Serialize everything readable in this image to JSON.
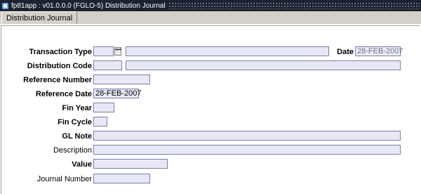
{
  "window": {
    "title": "fp81app : v01.0.0.0 (FGLO-5) Distribution Journal"
  },
  "tabs": [
    {
      "label": "Distribution Journal"
    }
  ],
  "form": {
    "transaction_type": {
      "label": "Transaction Type",
      "code": "",
      "description": ""
    },
    "date": {
      "label": "Date",
      "value": "28-FEB-2007"
    },
    "distribution_code": {
      "label": "Distribution Code",
      "code": "",
      "description": ""
    },
    "reference_number": {
      "label": "Reference Number",
      "value": ""
    },
    "reference_date": {
      "label": "Reference Date",
      "value": "28-FEB-2007"
    },
    "fin_year": {
      "label": "Fin Year",
      "value": ""
    },
    "fin_cycle": {
      "label": "Fin Cycle",
      "value": ""
    },
    "gl_note": {
      "label": "GL Note",
      "value": ""
    },
    "description": {
      "label": "Description",
      "value": ""
    },
    "value": {
      "label": "Value",
      "value": ""
    },
    "journal_number": {
      "label": "Journal Number",
      "value": ""
    }
  },
  "icons": {
    "app": "app-icon",
    "lov": "ellipsis-icon"
  }
}
